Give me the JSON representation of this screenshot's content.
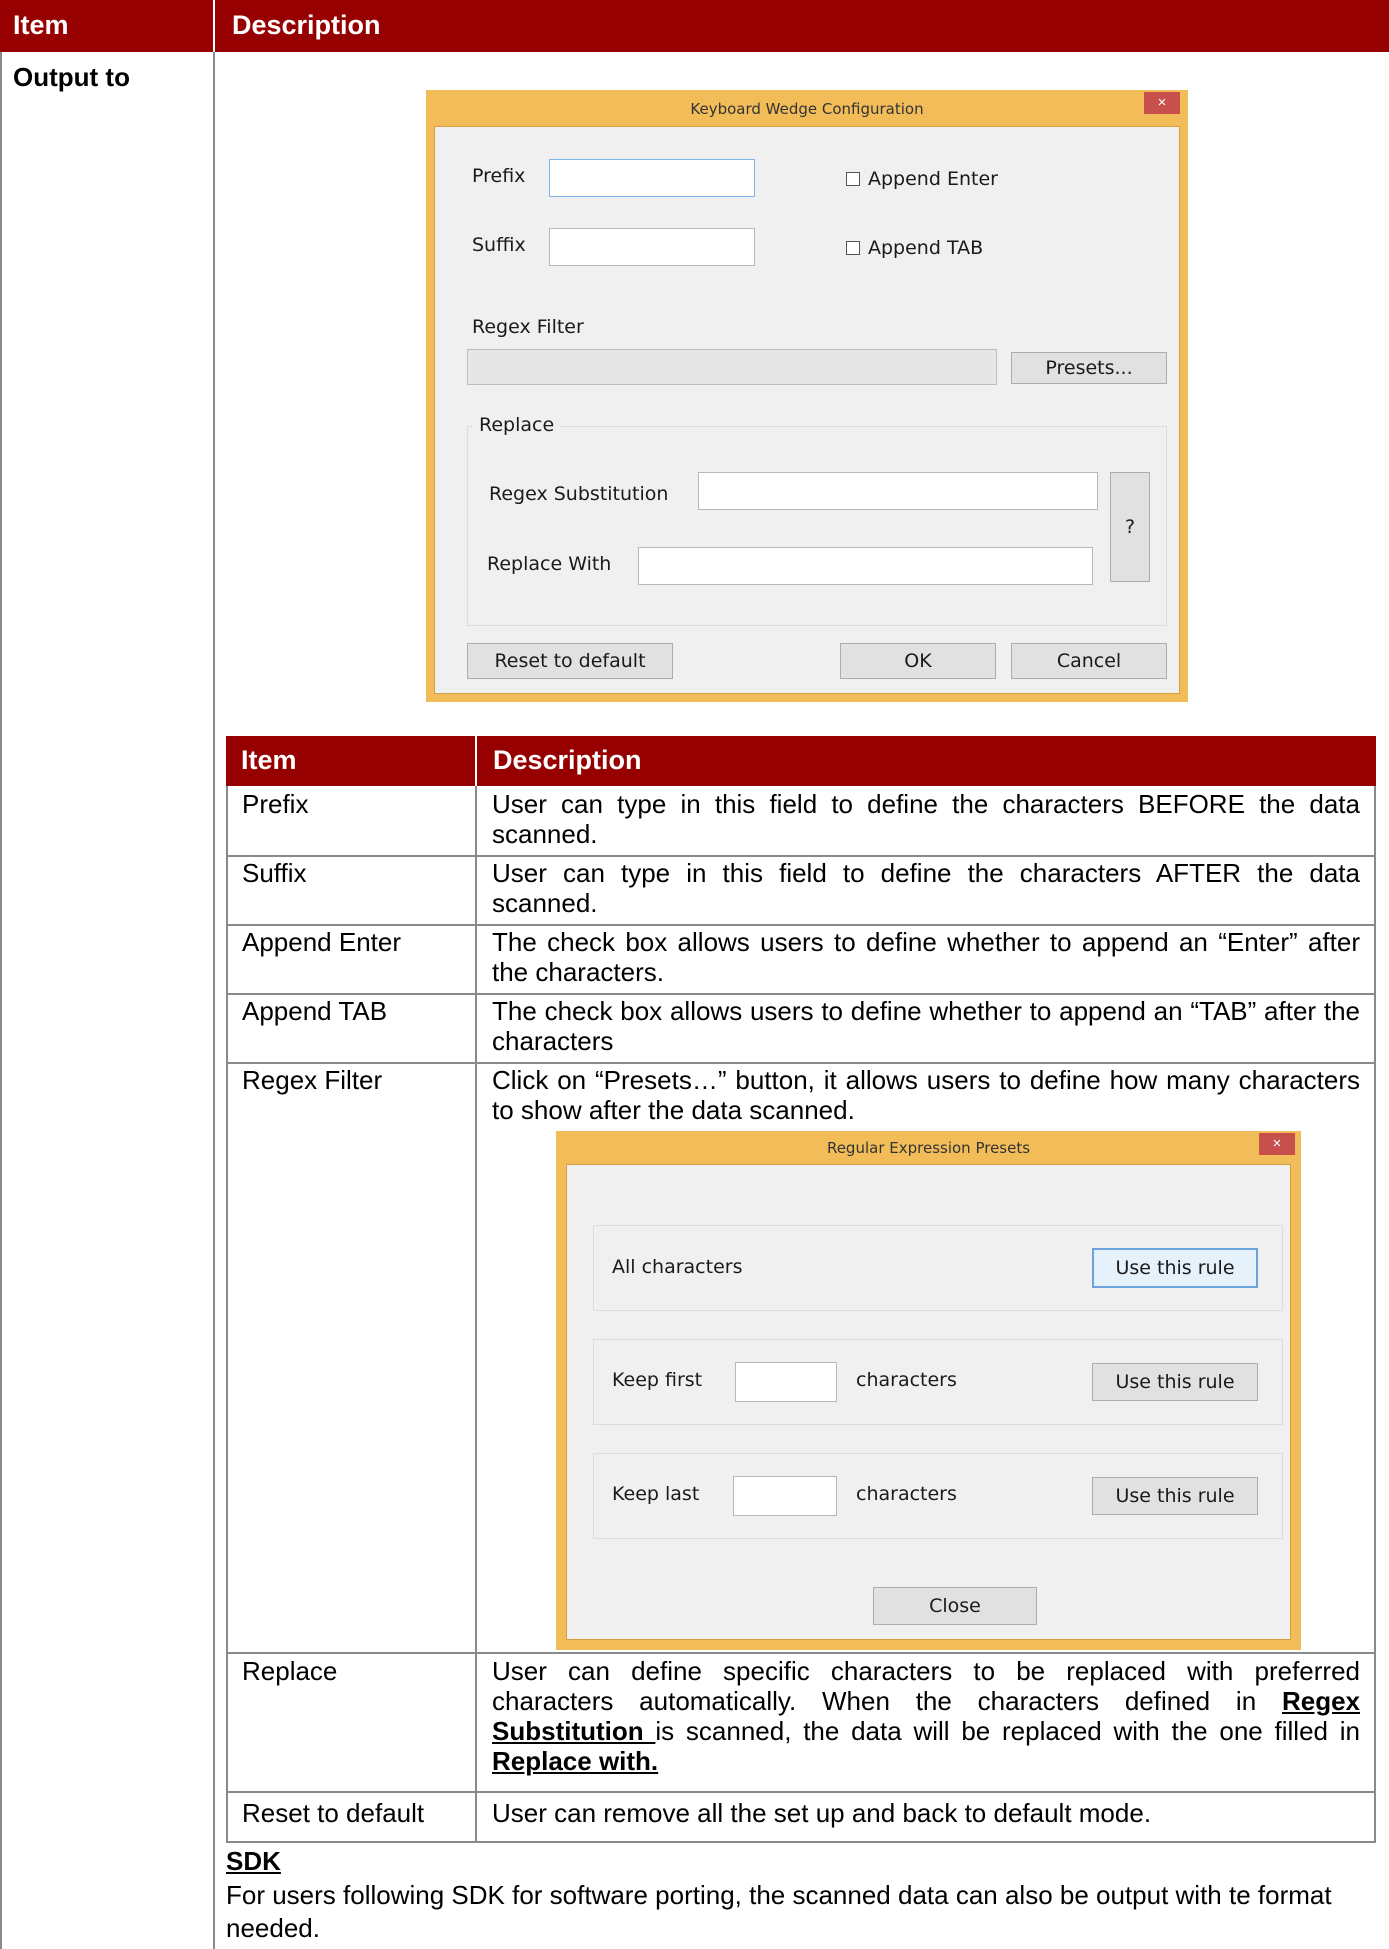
{
  "outer_table": {
    "header_item": "Item",
    "header_description": "Description",
    "row_item": "Output to"
  },
  "keyboard_dialog": {
    "title": "Keyboard Wedge Configuration",
    "close_glyph": "×",
    "prefix_label": "Prefix",
    "suffix_label": "Suffix",
    "append_enter_label": "Append Enter",
    "append_tab_label": "Append TAB",
    "regex_filter_label": "Regex Filter",
    "presets_button": "Presets...",
    "replace_group": "Replace",
    "regex_substitution_label": "Regex Substitution",
    "replace_with_label": "Replace With",
    "help_button": "?",
    "reset_button": "Reset to default",
    "ok_button": "OK",
    "cancel_button": "Cancel"
  },
  "inner_table": {
    "header_item": "Item",
    "header_description": "Description",
    "rows": [
      {
        "item": "Prefix",
        "description": "User can type in this field to define the characters BEFORE the data scanned."
      },
      {
        "item": "Suffix",
        "description": "User can type in this field to define the characters AFTER the data scanned."
      },
      {
        "item": "Append Enter",
        "description": "The check box allows users to define whether to append an “Enter” after the characters."
      },
      {
        "item": "Append TAB",
        "description": "The check box allows users to define whether to append an “TAB” after the characters"
      },
      {
        "item": "Regex Filter",
        "description": "Click on “Presets…” button, it allows users to define how many characters to show after the data scanned."
      },
      {
        "item": "Replace",
        "description_parts": [
          "User can define specific characters to be replaced with preferred characters automatically. When the characters defined in ",
          "Regex Substitution ",
          "is scanned, the data will be replaced with the one filled in ",
          "Replace with."
        ]
      },
      {
        "item": "Reset to default",
        "description": "User can remove all the set up and back to default mode."
      }
    ]
  },
  "presets_dialog": {
    "title": "Regular Expression Presets",
    "close_glyph": "×",
    "all_characters": "All characters",
    "keep_first": "Keep first",
    "keep_last": "Keep last",
    "characters_1": "characters",
    "characters_2": "characters",
    "use_rule_1": "Use this rule",
    "use_rule_2": "Use this rule",
    "use_rule_3": "Use this rule",
    "close_button": "Close"
  },
  "sdk": {
    "heading": "SDK",
    "text": "For users following SDK for software porting, the scanned data can also be output with te format needed."
  },
  "colors": {
    "header_bg": "#960000",
    "dialog_frame": "#f2bd59",
    "dialog_close": "#c7504d"
  }
}
